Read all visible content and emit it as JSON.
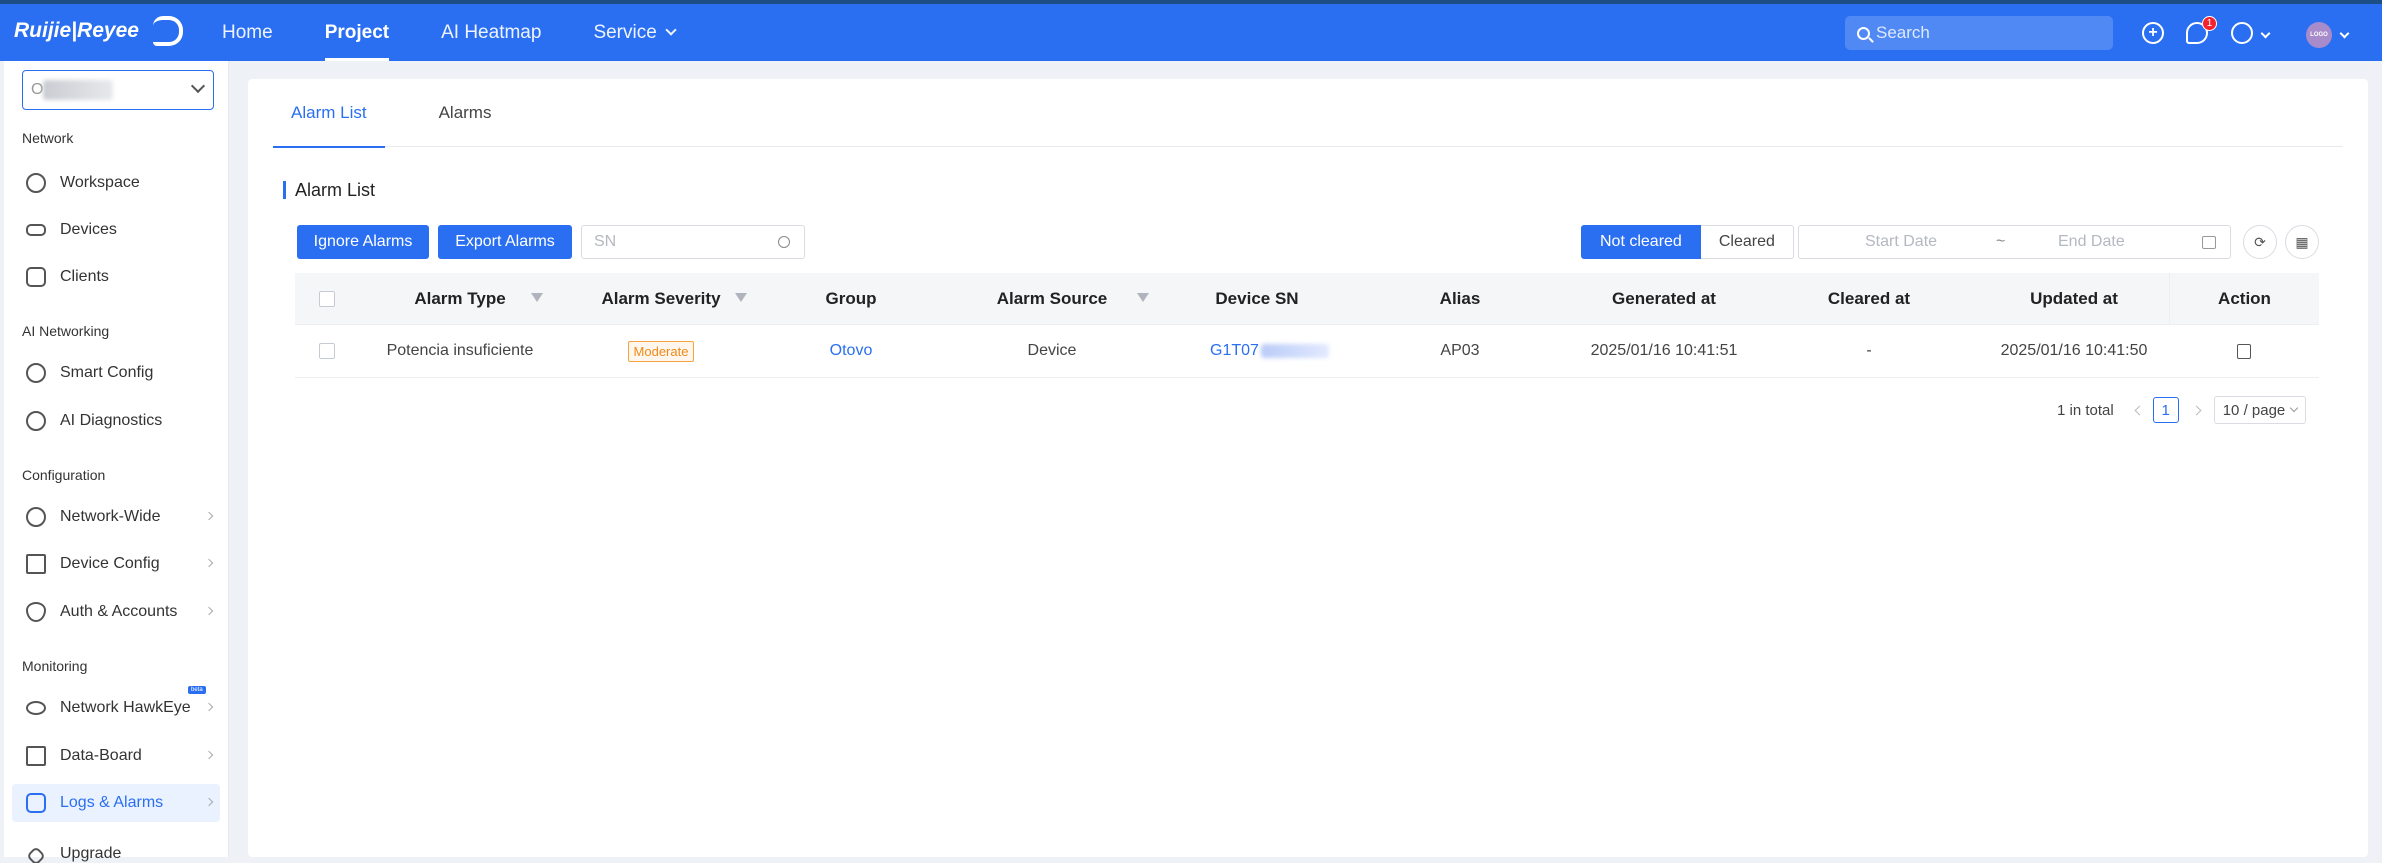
{
  "header": {
    "logo_text": "Ruijie|Reyee",
    "nav": [
      {
        "label": "Home"
      },
      {
        "label": "Project"
      },
      {
        "label": "AI Heatmap"
      },
      {
        "label": "Service"
      }
    ],
    "search_placeholder": "Search",
    "notification_count": "1",
    "avatar_text": "LOGO"
  },
  "sidebar": {
    "site_value": "O",
    "groups": {
      "network": "Network",
      "ai_networking": "AI Networking",
      "configuration": "Configuration",
      "monitoring": "Monitoring"
    },
    "items": {
      "workspace": "Workspace",
      "devices": "Devices",
      "clients": "Clients",
      "smart_config": "Smart Config",
      "ai_diagnostics": "AI Diagnostics",
      "network_wide": "Network-Wide",
      "device_config": "Device Config",
      "auth_accounts": "Auth & Accounts",
      "network_hawkeye": "Network HawkEye",
      "data_board": "Data-Board",
      "logs_alarms": "Logs & Alarms",
      "upgrade": "Upgrade"
    },
    "beta_label": "beta"
  },
  "main": {
    "tabs": [
      {
        "label": "Alarm List"
      },
      {
        "label": "Alarms"
      }
    ],
    "section_title": "Alarm List",
    "buttons": {
      "ignore": "Ignore Alarms",
      "export": "Export Alarms"
    },
    "sn_placeholder": "SN",
    "status_toggle": {
      "not_cleared": "Not cleared",
      "cleared": "Cleared"
    },
    "date_range": {
      "start": "Start Date",
      "separator": "~",
      "end": "End Date"
    },
    "table": {
      "columns": [
        "Alarm Type",
        "Alarm Severity",
        "Group",
        "Alarm Source",
        "Device SN",
        "Alias",
        "Generated at",
        "Cleared at",
        "Updated at",
        "Action"
      ],
      "rows": [
        {
          "alarm_type": "Potencia insuficiente",
          "severity": "Moderate",
          "group": "Otovo",
          "source": "Device",
          "device_sn": "G1T07",
          "alias": "AP03",
          "generated_at": "2025/01/16 10:41:51",
          "cleared_at": "-",
          "updated_at": "2025/01/16 10:41:50"
        }
      ]
    },
    "pagination": {
      "total": "1 in total",
      "current_page": "1",
      "page_size": "10 / page"
    }
  },
  "colors": {
    "brand": "#2a6ff1",
    "moderate": "#ef8a16"
  }
}
